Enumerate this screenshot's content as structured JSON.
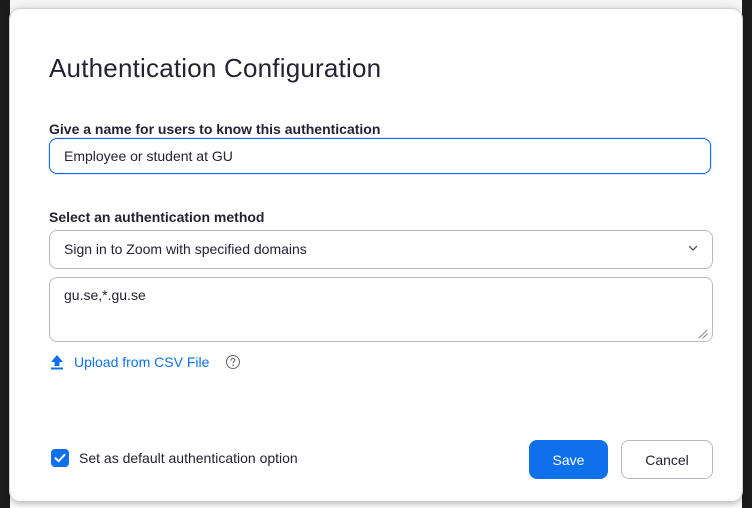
{
  "dialog": {
    "title": "Authentication Configuration",
    "name_label": "Give a name for users to know this authentication",
    "name_value": "Employee or student at GU",
    "method_label": "Select an authentication method",
    "method_value": "Sign in to Zoom with specified domains",
    "domains_value": "gu.se,*.gu.se",
    "upload_label": "Upload from CSV File",
    "default_option_label": "Set as default authentication option",
    "default_option_checked": true,
    "save_label": "Save",
    "cancel_label": "Cancel"
  },
  "icons": {
    "method_dropdown": "chevron-down-icon",
    "upload": "upload-arrow-icon",
    "help": "help-question-icon",
    "checkbox": "check-icon",
    "resize": "resize-grip-icon"
  },
  "colors": {
    "accent": "#0e71eb",
    "text": "#232333",
    "border": "#bababa"
  }
}
